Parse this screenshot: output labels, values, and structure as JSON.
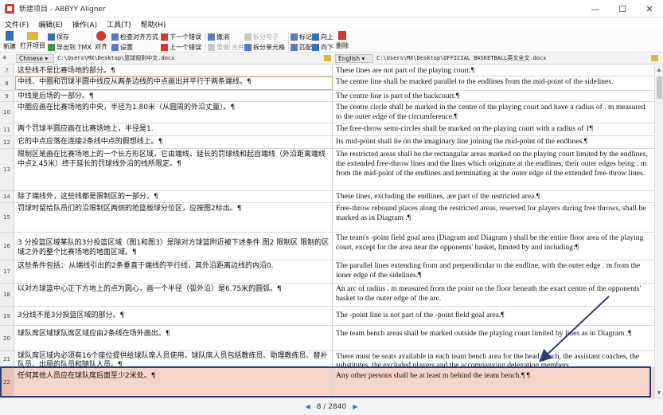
{
  "window": {
    "title": "新建项目 - ABBYY Aligner",
    "minimize": "—",
    "maximize": "☐",
    "close": "✕"
  },
  "menu": [
    "文件(F)",
    "编辑(E)",
    "操作(A)",
    "工具(T)",
    "帮助(H)"
  ],
  "toolbar": {
    "new": "新建",
    "open": "打开项目",
    "save": "保存",
    "export_tmx": "导出到 TMX",
    "align": "对齐",
    "check_align": "检查对齐方式",
    "settings": "设置",
    "next_error": "下一个错误",
    "prev_error": "上一个错误",
    "undo": "撤消",
    "redo": "重做",
    "merge": "合并",
    "split_sentence": "拆分句子",
    "split_cell": "拆分单元格",
    "mark": "标记",
    "match": "匹配",
    "up": "向上",
    "down": "向下",
    "delete": "删除"
  },
  "pathbar": {
    "left_lang": "Chinese",
    "left_path": "C:\\Users\\MX\\Desktop\\篮球规则中文.docx",
    "right_lang": "English",
    "right_path": "C:\\Users\\MX\\Desktop\\OFFICIAL BASKETBALL英文全文.docx"
  },
  "rows": [
    {
      "n": "7",
      "zh": "这些线不是比赛场地的部分。¶",
      "en": "These lines are not part of the playing court.¶"
    },
    {
      "n": "8",
      "zh": "中线、中圈和罚球半圆中线应从两条边线的中点画出并平行于两条端线。¶",
      "en": "The centre line shall be marked parallel to the endlines from the mid-point of the sidelines."
    },
    {
      "n": "9",
      "zh": "中线是后场的一部分。¶",
      "en": "The centre line is part of the backcourt.¶"
    },
    {
      "n": "10",
      "zh": "中圈应画在比赛场地的中央，半径为1.80米（从圆周的外沿丈量）。¶",
      "en": "The centre circle shall be marked in the centre of the playing court and have a radius of . m measured to the outer edge of the circumference.¶"
    },
    {
      "n": "11",
      "zh": "两个罚球半圆应画在比赛场地上，半径是1.",
      "en": "The free-throw semi-circles shall be marked on the playing court with a radius of 1¶"
    },
    {
      "n": "12",
      "zh": "它的中点应落在连接2条线中点的假想线上。¶",
      "en": "Its mid-point shall lie on the imaginary line joining the mid-point of the endlines.¶"
    },
    {
      "n": "13",
      "zh": "限制区是画在比赛场地上的一个长方形区域，它由端线、延长的罚球线和起自端线（外沿距离端线中点2.45米）终于延长的罚球线外沿的线所限定。¶",
      "en": "The restricted areas shall be the rectangular areas marked on the playing court limited by the endlines, the extended free-throw lines and the lines which originate at the endlines, their outer edges being . m from the mid-point of the endlines and terminating at the outer edge of the extended free-throw lines."
    },
    {
      "n": "14",
      "zh": "除了端线外，这些线都是限制区的一部分。¶",
      "en": "These lines, excluding the endlines, are part of the restricted area.¶"
    },
    {
      "n": "15",
      "zh": "罚球时留给队员们的沿限制区两侧的抢篮板球分位区，应按图2标出。¶",
      "en": "Free-throw rebound places along the restricted areas, reserved for players during free throws, shall be marked as in Diagram .¶"
    },
    {
      "n": "16",
      "zh": "3 分投篮区域某队的3分投篮区域（图1和图3）是除对方球篮附近被下述条件  图2 限制区 限制的区域之外的整个比赛场地的地面区域。¶",
      "en": "The team's -point field goal area (Diagram and Diagram ) shall be the entire floor area of the playing court, except for the area near the opponents' basket, limited by and including:¶"
    },
    {
      "n": "17",
      "zh": "这些条件包括：· 从端线引出的2条垂直于端线的平行线，其外沿距离边线的内沿0.",
      "en": "The parallel lines extending from and perpendicular to the endline, with the outer edge . m from the inner edge of the sidelines.¶"
    },
    {
      "n": "18",
      "zh": "以对方球篮中心正下方地上的点为圆心，画一个半径（弧外沿）是6.75米的圆弧。¶",
      "en": "An arc of radius . m measured from the point on the floor beneath the exact centre of the opponents' basket to the outer edge of the arc."
    },
    {
      "n": "19",
      "zh": "3分线不是3分投篮区域的部分。¶",
      "en": "The -point line is not part of the -point field goal area.¶"
    },
    {
      "n": "20",
      "zh": "球队席区域球队席区域应由2条线在场外画出。¶",
      "en": "The team bench areas shall be marked outside the playing court limited by lines as in Diagram .¶"
    },
    {
      "n": "21",
      "zh": "球队席区域内必须有16个座位提供给球队席人员使用，球队席人员包括教练员、助理教练员、替补队员、出局的队员和随队人员。¶",
      "en": "There must be seats available in each team bench area for the head coach, the assistant coaches, the substitutes, the excluded players and the accompanying delegation members."
    },
    {
      "n": "22",
      "zh": "任何其他人员应在球队席后面至少2米处。¶",
      "en": "Any other persons shall be at least m behind the team bench.¶ ¶"
    }
  ],
  "status": {
    "page": "8 / 2840",
    "prev": "◀",
    "next": "▶"
  },
  "colors": {
    "selected_row": "#f5d5c8",
    "highlight_box": "#2c3f7a",
    "arrow": "#2c3f7a"
  }
}
